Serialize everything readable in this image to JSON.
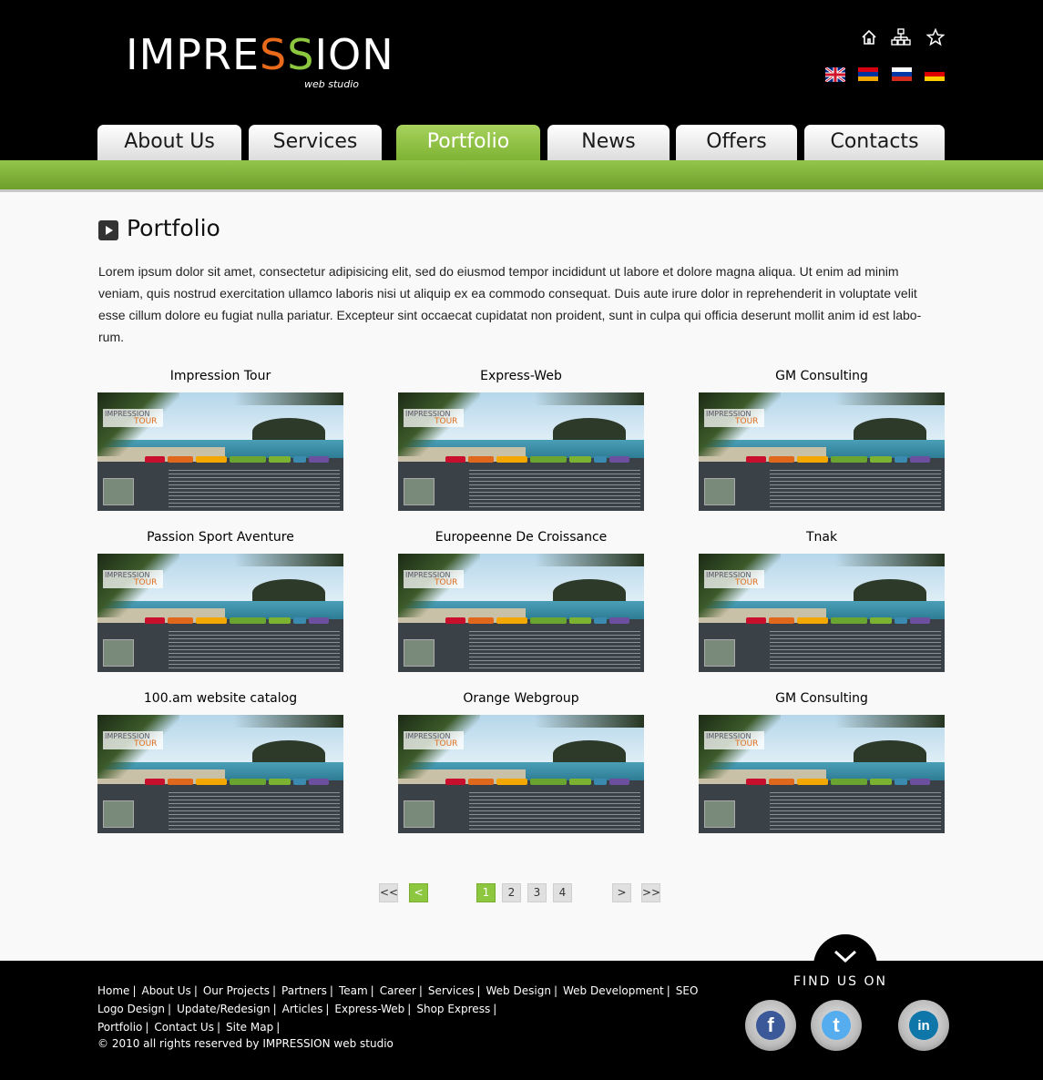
{
  "logo": {
    "text_pre": "IMPRE",
    "s1": "S",
    "s2": "S",
    "text_post": "ION",
    "sub": "web studio"
  },
  "header_icons": [
    "home-icon",
    "sitemap-icon",
    "star-icon"
  ],
  "languages": [
    {
      "name": "english-flag",
      "colors": [
        "#cf142b",
        "#ffffff",
        "#00247d",
        "#ffffff"
      ]
    },
    {
      "name": "armenian-flag",
      "colors": [
        "#d90012",
        "#0033a0",
        "#f2a800"
      ]
    },
    {
      "name": "russian-flag",
      "colors": [
        "#ffffff",
        "#0039a6",
        "#d52b1e"
      ]
    },
    {
      "name": "german-flag",
      "colors": [
        "#000000",
        "#dd0000",
        "#ffce00"
      ]
    }
  ],
  "nav": {
    "tabs": [
      {
        "label": "About Us"
      },
      {
        "label": "Services"
      },
      {
        "label": "Portfolio",
        "active": true
      },
      {
        "label": "News"
      },
      {
        "label": "Offers"
      },
      {
        "label": "Contacts"
      }
    ]
  },
  "main": {
    "title": "Portfolio",
    "intro": "Lorem ipsum dolor sit amet, consectetur adipisicing elit, sed do eiusmod tempor incididunt ut labore et dolore magna aliqua. Ut enim ad minim veniam, quis nostrud exercitation ullamco laboris nisi ut aliquip ex ea commodo consequat. Duis aute irure dolor in reprehenderit in voluptate velit esse cillum dolore eu fugiat nulla pariatur. Excepteur sint occaecat cupidatat non proident, sunt in culpa qui officia deserunt mollit anim id est labo-rum.",
    "thumb_logo": {
      "line1": "IMPRESSION",
      "line2": "TOUR"
    },
    "items": [
      {
        "title": "Impression Tour"
      },
      {
        "title": "Express-Web"
      },
      {
        "title": "GM Consulting"
      },
      {
        "title": "Passion Sport Aventure"
      },
      {
        "title": "Europeenne De Croissance"
      },
      {
        "title": "Tnak"
      },
      {
        "title": "100.am website catalog"
      },
      {
        "title": "Orange Webgroup"
      },
      {
        "title": "GM Consulting"
      }
    ]
  },
  "pagination": {
    "first": "<<",
    "prev": "<",
    "pages": [
      "1",
      "2",
      "3",
      "4"
    ],
    "current_page": "1",
    "next": ">",
    "last": ">>"
  },
  "footer": {
    "links_row1": [
      "Home",
      "About Us",
      "Our Projects",
      "Partners",
      "Team",
      "Career",
      "Services",
      "Web Design",
      "Web Development",
      "SEO"
    ],
    "links_row2": [
      "Logo Design",
      "Update/Redesign",
      "Articles",
      "Express-Web",
      "Shop Express"
    ],
    "links_row3": [
      "Portfolio",
      "Contact Us",
      "Site Map"
    ],
    "copyright": "© 2010 all rights reserved by IMPRESSION web studio",
    "find_us": "FIND US ON",
    "social": [
      {
        "name": "facebook-icon",
        "glyph": "f",
        "color": "#3b5998"
      },
      {
        "name": "twitter-icon",
        "glyph": "t",
        "color": "#55acee"
      },
      {
        "name": "linkedin-icon",
        "glyph": "in",
        "color": "#0e76a8"
      }
    ]
  },
  "colors": {
    "accent": "#8dc63f",
    "orange": "#e86a1a",
    "header_bg": "#000000"
  }
}
